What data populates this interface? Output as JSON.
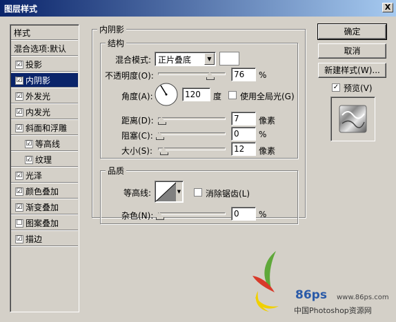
{
  "window": {
    "title": "图层样式",
    "close_label": "X"
  },
  "sidebar": {
    "header": "样式",
    "blend_options": "混合选项:默认",
    "items": [
      {
        "label": "投影",
        "checked": "☑"
      },
      {
        "label": "内阴影",
        "checked": "☑"
      },
      {
        "label": "外发光",
        "checked": "☑"
      },
      {
        "label": "内发光",
        "checked": "☑"
      },
      {
        "label": "斜面和浮雕",
        "checked": "☑"
      },
      {
        "label": "等高线",
        "checked": "☑"
      },
      {
        "label": "纹理",
        "checked": "☑"
      },
      {
        "label": "光泽",
        "checked": "☑"
      },
      {
        "label": "颜色叠加",
        "checked": "☑"
      },
      {
        "label": "渐变叠加",
        "checked": "☑"
      },
      {
        "label": "图案叠加",
        "checked": "☐"
      },
      {
        "label": "描边",
        "checked": "☑"
      }
    ]
  },
  "panel": {
    "title": "内阴影",
    "structure": {
      "title": "结构",
      "blend_mode_label": "混合模式:",
      "blend_mode_value": "正片叠底",
      "opacity_label": "不透明度(O):",
      "opacity_value": "76",
      "opacity_unit": "%",
      "angle_label": "角度(A):",
      "angle_value": "120",
      "angle_unit": "度",
      "global_light_label": "使用全局光(G)",
      "distance_label": "距离(D):",
      "distance_value": "7",
      "distance_unit": "像素",
      "choke_label": "阻塞(C):",
      "choke_value": "0",
      "choke_unit": "%",
      "size_label": "大小(S):",
      "size_value": "12",
      "size_unit": "像素"
    },
    "quality": {
      "title": "品质",
      "contour_label": "等高线:",
      "antialias_label": "消除锯齿(L)",
      "noise_label": "杂色(N):",
      "noise_value": "0",
      "noise_unit": "%"
    }
  },
  "buttons": {
    "ok": "确定",
    "cancel": "取消",
    "new_style": "新建样式(W)...",
    "preview_label": "预览(V)"
  },
  "watermark": {
    "site": "www.86ps.com",
    "name": "中国Photoshop资源网",
    "logo_text": "86ps"
  }
}
